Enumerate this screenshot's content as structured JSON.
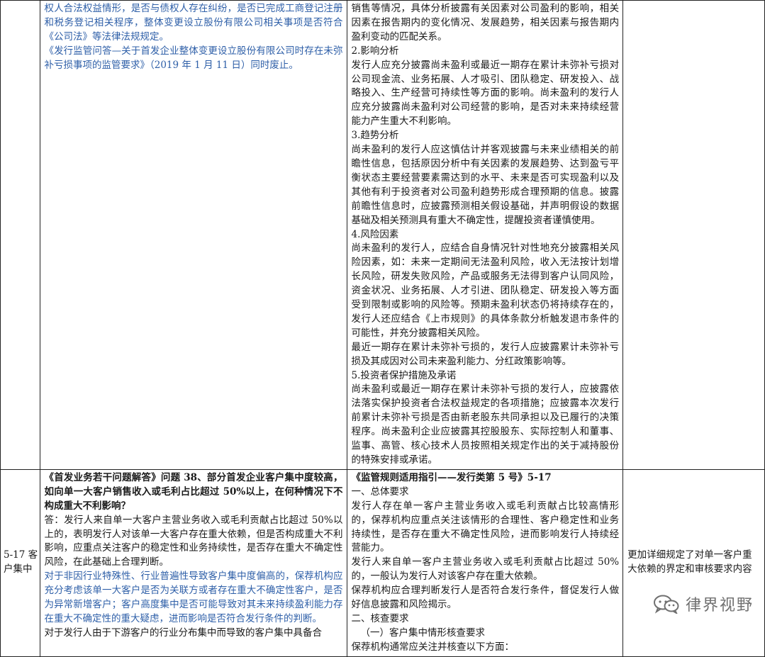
{
  "row1": {
    "left": [
      {
        "text": "权人合法权益情形，是否与债权人存在纠纷，是否已完成工商登记注册和税务登记相关程序，整体变更设立股份有限公司相关事项是否符合《公司法》等法律法规规定。",
        "style": "blue"
      },
      {
        "text": "《发行监管问答—关于首发企业整体变更设立股份有限公司时存在未弥补亏损事项的监管要求》（2019 年 1 月 11 日）同时废止。",
        "style": "blue"
      }
    ],
    "right": [
      "销售等情况，具体分析披露有关因素对公司盈利的影响，相关因素在报告期内的变化情况、发展趋势，相关因素与报告期内盈利变动的匹配关系。",
      "2.影响分析",
      "发行人应充分披露尚未盈利或最近一期存在累计未弥补亏损对公司现金流、业务拓展、人才吸引、团队稳定、研发投入、战略投入、生产经营可持续性等方面的影响。尚未盈利的发行人应充分披露尚未盈利对公司经营的影响，是否对未来持续经营能力产生重大不利影响。",
      "3.趋势分析",
      "尚未盈利的发行人应这慎估计并客观披露与未来业绩相关的前瞻性信息，包括原因分析中有关因素的发展趋势、达到盈亏平衡状态主要经营要素需达到的水平、未来是否可实现盈利以及其他有利于投资者对公司盈利趋势形成合理预期的信息。披露前瞻性信息时，应披露预测相关假设基础，并声明假设的数据基础及相关预测具有重大不确定性，提醒投资者谨慎使用。",
      "4.风险因素",
      "尚未盈利的发行人，应结合自身情况针对性地充分披露相关风险因素，如：未来一定期间无法盈利风险，收入无法按计划增长风险，研发失败风险，产品或服务无法得到客户认同风险，资金状况、业务拓展、人才引进、团队稳定、研发投入等方面受到限制或影响的风险等。预期未盈利状态仍将持续存在的，发行人还应结合《上市规则》的具体条款分析触发退市条件的可能性，并充分披露相关风险。",
      "最近一期存在累计未弥补亏损的，发行人应披露累计未弥补亏损及其成因对公司未来盈利能力、分红政策影响等。",
      "5.投资者保护措施及承诺",
      "尚未盈利或最近一期存在累计未弥补亏损的发行人，应披露依法落实保护投资者合法权益规定的各项措施；应披露本次发行前累计未弥补亏损是否由新老股东共同承担以及已履行的决策程序。尚未盈利企业应披露其控股股东、实际控制人和董事、监事、高管、核心技术人员按照相关规定作出的关于减持股份的特殊安排或承诺。"
    ]
  },
  "row2": {
    "label": "5-17 客户集中",
    "left": [
      {
        "text": "《首发业务若干问题解答》问题 38、部分首发企业客户集中度较高，如向单一大客户销售收入或毛利占比超过 50%以上，在何种情况下不构成重大不利影响？",
        "style": "bold"
      },
      {
        "text": "答：发行人来自单一大客户主营业务收入或毛利贡献占比超过 50%以上的，表明发行人对该单一大客户存在重大依赖，但是否构成重大不利影响，应重点关注客户的稳定性和业务持续性，是否存在重大不确定性风险，在此基础上合理判断。",
        "style": "plain"
      },
      {
        "text": "对于非因行业特殊性、行业普遍性导致客户集中度偏高的，保荐机构应充分考虑该单一大客户是否为关联方或者存在重大不确定性客户，是否为异常新增客户；客户高度集中是否可能导致对其未来持续盈利能力存在重大不确定性的重大疑虑，进而影响是否符合发行条件的判断。",
        "style": "blue"
      },
      {
        "text": "对于发行人由于下游客户的行业分布集中而导致的客户集中具备合",
        "style": "plain"
      }
    ],
    "right": [
      {
        "text": "《监管规则适用指引——发行类第 5 号》5-17",
        "style": "bold"
      },
      {
        "text": "一、总体要求",
        "style": "plain"
      },
      {
        "text": "发行人存在单一客户主营业务收入或毛利贡献占比较高情形的，保荐机构应重点关注该情形的合理性、客户稳定性和业务持续性，是否存在重大不确定性风险，进而影响发行人持续经营能力。",
        "style": "plain"
      },
      {
        "text": "发行人来自单一客户主营业务收入或毛利贡献占比超过 50%的，一般认为发行人对该客户存在重大依赖。",
        "style": "plain"
      },
      {
        "text": "保荐机构应合理判断发行人是否符合发行条件，督促发行人做好信息披露和风险揭示。",
        "style": "plain"
      },
      {
        "text": "二、核查要求",
        "style": "plain"
      },
      {
        "text": "（一）客户集中情形核查要求",
        "style": "indent"
      },
      {
        "text": "保荐机构通常应关注并核查以下方面：",
        "style": "plain"
      }
    ],
    "note": "更加详细规定了对单一客户重大依赖的界定和审核要求内容"
  },
  "watermark": {
    "text": "律界视野",
    "icon": "wechat-icon"
  }
}
